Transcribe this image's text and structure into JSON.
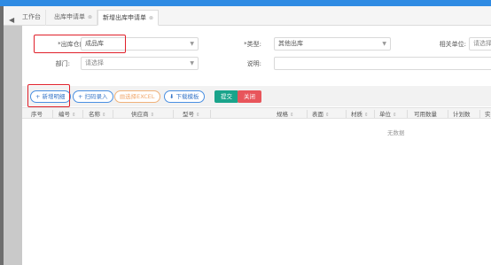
{
  "tabs": [
    {
      "label": "工作台",
      "closable": false
    },
    {
      "label": "出库申请单",
      "closable": true
    },
    {
      "label": "新增出库申请单",
      "closable": true,
      "active": true
    }
  ],
  "form": {
    "warehouse": {
      "label": "*出库仓库:",
      "value": "成品库"
    },
    "type": {
      "label": "*类型:",
      "value": "其他出库"
    },
    "related_unit": {
      "label": "相关单位:",
      "placeholder": "请选择"
    },
    "department": {
      "label": "部门:",
      "placeholder": "请选择"
    },
    "description": {
      "label": "说明:",
      "value": ""
    }
  },
  "toolbar": {
    "add_detail": "+ 新增明细",
    "scan_entry": "+ 扫码录入",
    "select_excel": "选择EXCEL",
    "download_template": "下载模板",
    "submit": "提交",
    "close": "关闭"
  },
  "table": {
    "columns": [
      "序号",
      "编号",
      "名称",
      "供应商",
      "型号",
      "规格",
      "表面",
      "材质",
      "单位",
      "可用数量",
      "计划数",
      "实"
    ],
    "empty_text": "无数据"
  },
  "colors": {
    "accent": "#2f8be3",
    "highlight": "#e0202a",
    "submit": "#1aa48b",
    "close": "#e8555b"
  }
}
